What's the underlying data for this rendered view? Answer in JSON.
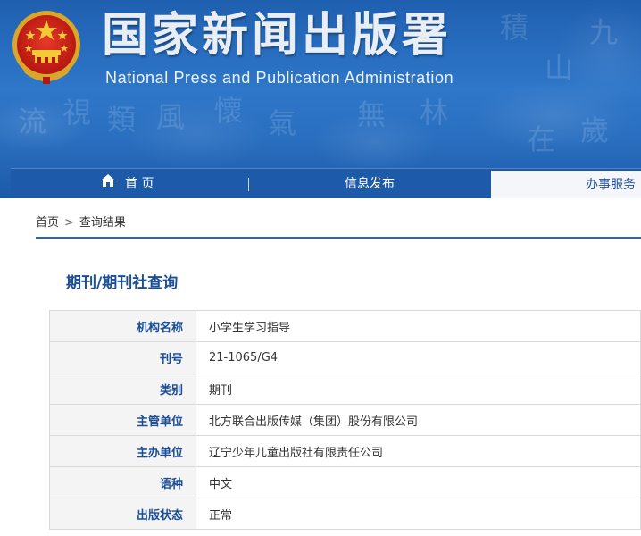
{
  "header": {
    "title_cn": "国家新闻出版署",
    "title_en": "National Press and Publication Administration",
    "emblem": "national-emblem-icon",
    "background_color": "#2a6fc0"
  },
  "nav": {
    "home": "首 页",
    "info": "信息发布",
    "service": "办事服务",
    "home_icon": "home-icon"
  },
  "breadcrumb": {
    "home": "首页",
    "separator": ">",
    "current": "查询结果"
  },
  "section_title": "期刊/期刊社查询",
  "table": {
    "rows": [
      {
        "key": "机构名称",
        "value": "小学生学习指导"
      },
      {
        "key": "刊号",
        "value": "21-1065/G4"
      },
      {
        "key": "类别",
        "value": "期刊"
      },
      {
        "key": "主管单位",
        "value": "北方联合出版传媒（集团）股份有限公司"
      },
      {
        "key": "主办单位",
        "value": "辽宁少年儿童出版社有限责任公司"
      },
      {
        "key": "语种",
        "value": "中文"
      },
      {
        "key": "出版状态",
        "value": "正常"
      }
    ]
  },
  "colors": {
    "accent": "#1a4e97",
    "nav_bg": "#1d5aa9",
    "rule": "#2c66b1"
  }
}
